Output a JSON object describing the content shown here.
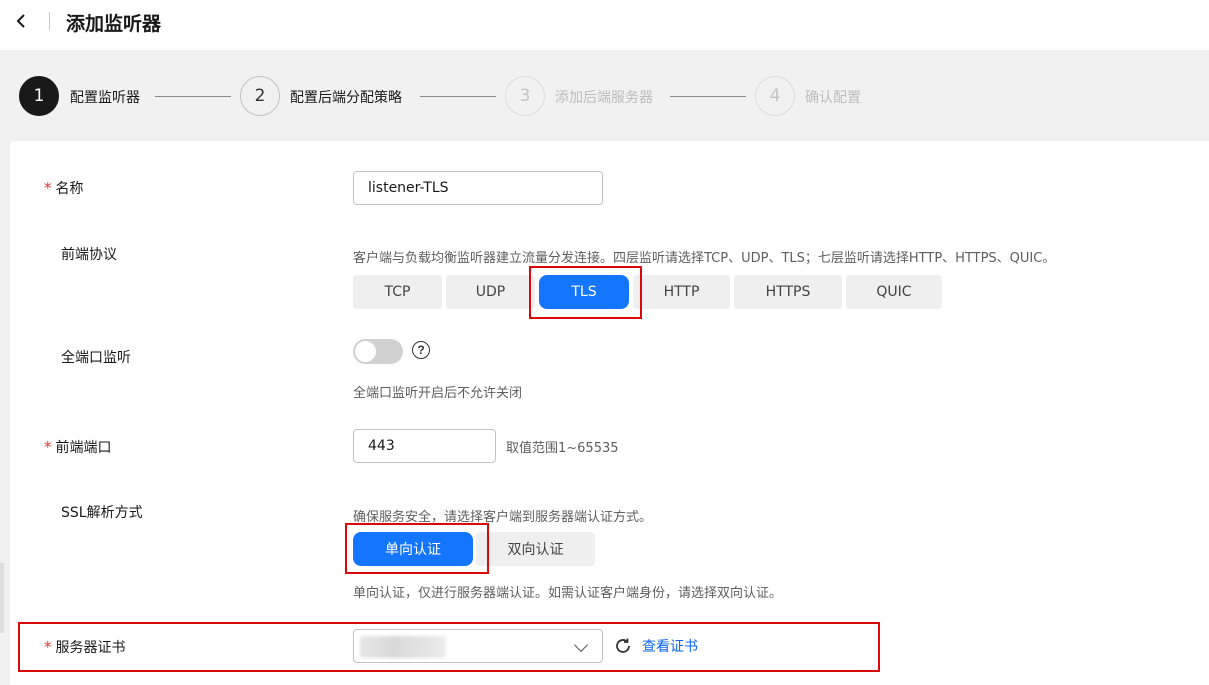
{
  "header": {
    "title": "添加监听器"
  },
  "steps": [
    {
      "number": "1",
      "label": "配置监听器",
      "state": "active"
    },
    {
      "number": "2",
      "label": "配置后端分配策略",
      "state": "normal"
    },
    {
      "number": "3",
      "label": "添加后端服务器",
      "state": "disabled"
    },
    {
      "number": "4",
      "label": "确认配置",
      "state": "disabled"
    }
  ],
  "form": {
    "required_mark": "*",
    "name": {
      "label": "名称",
      "value": "listener-TLS"
    },
    "protocol": {
      "label": "前端协议",
      "hint": "客户端与负载均衡监听器建立流量分发连接。四层监听请选择TCP、UDP、TLS；七层监听请选择HTTP、HTTPS、QUIC。",
      "options": [
        "TCP",
        "UDP",
        "TLS",
        "HTTP",
        "HTTPS",
        "QUIC"
      ],
      "selected": "TLS"
    },
    "all_port": {
      "label": "全端口监听",
      "enabled": false,
      "help_glyph": "?",
      "hint": "全端口监听开启后不允许关闭"
    },
    "port": {
      "label": "前端端口",
      "value": "443",
      "range_hint": "取值范围1~65535"
    },
    "ssl": {
      "label": "SSL解析方式",
      "hint": "确保服务安全，请选择客户端到服务器端认证方式。",
      "options": [
        "单向认证",
        "双向认证"
      ],
      "selected": "单向认证",
      "note": "单向认证，仅进行服务器端认证。如需认证客户端身份，请选择双向认证。"
    },
    "certificate": {
      "label": "服务器证书",
      "link": "查看证书"
    }
  },
  "icons": {
    "back": "chevron-left-icon",
    "help": "question-circle-icon",
    "dropdown": "chevron-down-icon",
    "refresh": "refresh-icon"
  },
  "colors": {
    "primary": "#1476ff",
    "required": "#e5332f",
    "highlight": "#d90a0a",
    "link": "#0d66f2"
  }
}
